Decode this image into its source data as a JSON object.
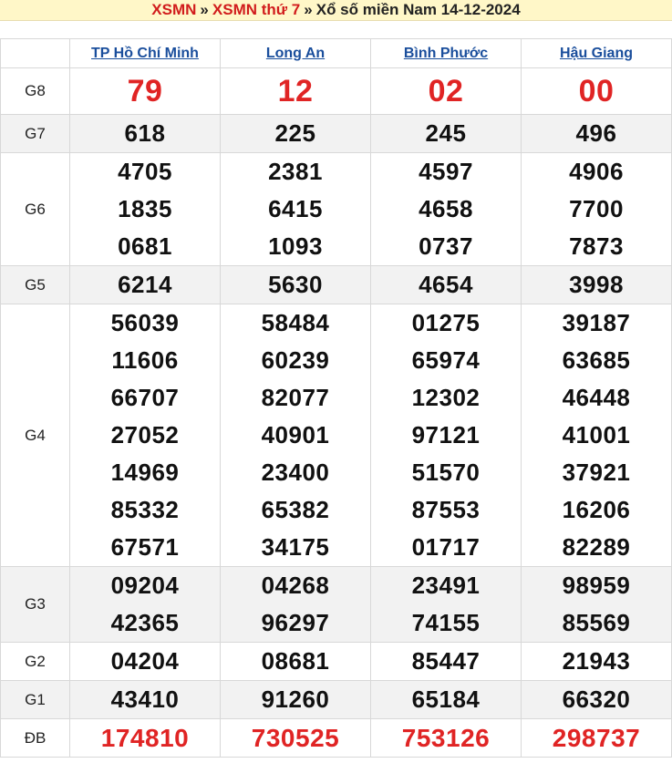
{
  "header": {
    "link1": "XSMN",
    "link2": "XSMN thứ 7",
    "sep": "»",
    "title": "Xổ số miền Nam 14-12-2024"
  },
  "provinces": [
    "TP Hồ Chí Minh",
    "Long An",
    "Bình Phước",
    "Hậu Giang"
  ],
  "colors": {
    "red": "#e02424",
    "link": "#1a4e9c",
    "header_bg": "#fff7c8"
  },
  "prizes": [
    {
      "label": "G8",
      "style": "big",
      "results": [
        [
          "79"
        ],
        [
          "12"
        ],
        [
          "02"
        ],
        [
          "00"
        ]
      ]
    },
    {
      "label": "G7",
      "style": "",
      "results": [
        [
          "618"
        ],
        [
          "225"
        ],
        [
          "245"
        ],
        [
          "496"
        ]
      ]
    },
    {
      "label": "G6",
      "style": "",
      "results": [
        [
          "4705",
          "1835",
          "0681"
        ],
        [
          "2381",
          "6415",
          "1093"
        ],
        [
          "4597",
          "4658",
          "0737"
        ],
        [
          "4906",
          "7700",
          "7873"
        ]
      ]
    },
    {
      "label": "G5",
      "style": "",
      "results": [
        [
          "6214"
        ],
        [
          "5630"
        ],
        [
          "4654"
        ],
        [
          "3998"
        ]
      ]
    },
    {
      "label": "G4",
      "style": "",
      "results": [
        [
          "56039",
          "11606",
          "66707",
          "27052",
          "14969",
          "85332",
          "67571"
        ],
        [
          "58484",
          "60239",
          "82077",
          "40901",
          "23400",
          "65382",
          "34175"
        ],
        [
          "01275",
          "65974",
          "12302",
          "97121",
          "51570",
          "87553",
          "01717"
        ],
        [
          "39187",
          "63685",
          "46448",
          "41001",
          "37921",
          "16206",
          "82289"
        ]
      ]
    },
    {
      "label": "G3",
      "style": "",
      "results": [
        [
          "09204",
          "42365"
        ],
        [
          "04268",
          "96297"
        ],
        [
          "23491",
          "74155"
        ],
        [
          "98959",
          "85569"
        ]
      ]
    },
    {
      "label": "G2",
      "style": "",
      "results": [
        [
          "04204"
        ],
        [
          "08681"
        ],
        [
          "85447"
        ],
        [
          "21943"
        ]
      ]
    },
    {
      "label": "G1",
      "style": "",
      "results": [
        [
          "43410"
        ],
        [
          "91260"
        ],
        [
          "65184"
        ],
        [
          "66320"
        ]
      ]
    },
    {
      "label": "ĐB",
      "style": "db",
      "results": [
        [
          "174810"
        ],
        [
          "730525"
        ],
        [
          "753126"
        ],
        [
          "298737"
        ]
      ]
    }
  ]
}
